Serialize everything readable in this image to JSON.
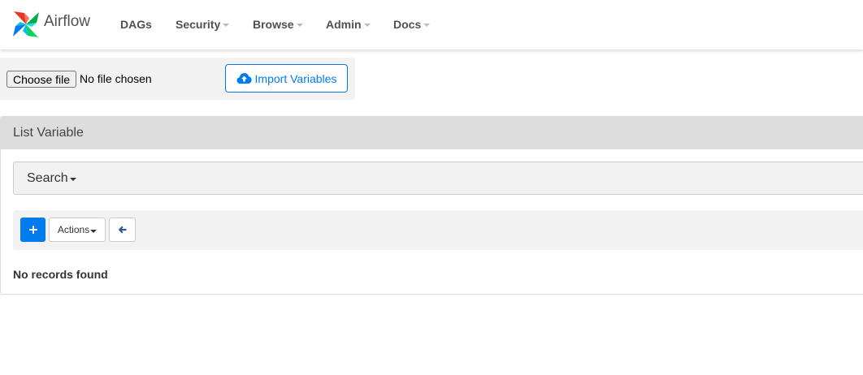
{
  "navbar": {
    "brand": "Airflow",
    "items": [
      {
        "label": "DAGs",
        "has_caret": false
      },
      {
        "label": "Security",
        "has_caret": true
      },
      {
        "label": "Browse",
        "has_caret": true
      },
      {
        "label": "Admin",
        "has_caret": true
      },
      {
        "label": "Docs",
        "has_caret": true
      }
    ]
  },
  "import": {
    "choose_file_label": "Choose file",
    "file_status": "No file chosen",
    "import_button_label": "Import Variables",
    "icon": "cloud-upload-icon"
  },
  "panel": {
    "title": "List Variable",
    "search_label": "Search",
    "actions_label": "Actions",
    "add_icon": "plus-icon",
    "back_icon": "arrow-left-icon",
    "empty_message": "No records found"
  },
  "colors": {
    "accent": "#017cee",
    "panel_heading_bg": "#dddddd",
    "toolbar_bg": "#f2f2f2"
  }
}
